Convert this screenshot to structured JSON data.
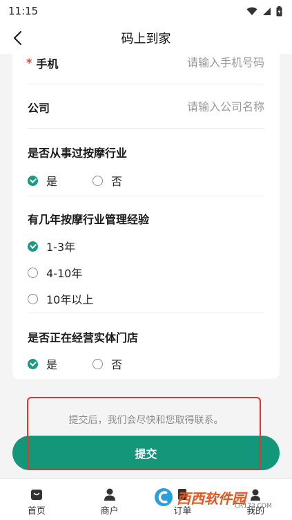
{
  "status_bar": {
    "time": "11:15"
  },
  "header": {
    "title": "码上到家"
  },
  "form": {
    "phone": {
      "required_mark": "*",
      "label": "手机",
      "placeholder": "请输入手机号码"
    },
    "company": {
      "label": "公司",
      "placeholder": "请输入公司名称"
    },
    "questions": [
      {
        "title": "是否从事过按摩行业",
        "options": [
          {
            "label": "是",
            "selected": true
          },
          {
            "label": "否",
            "selected": false
          }
        ]
      },
      {
        "title": "有几年按摩行业管理经验",
        "options": [
          {
            "label": "1-3年",
            "selected": true
          },
          {
            "label": "4-10年",
            "selected": false
          },
          {
            "label": "10年以上",
            "selected": false
          }
        ]
      },
      {
        "title": "是否正在经营实体门店",
        "options": [
          {
            "label": "是",
            "selected": true
          },
          {
            "label": "否",
            "selected": false
          }
        ]
      }
    ]
  },
  "notice": "提交后，我们会尽快和您取得联系。",
  "submit_label": "提交",
  "tab_bar": {
    "items": [
      {
        "label": "首页",
        "icon": "home-bag-icon"
      },
      {
        "label": "商户",
        "icon": "merchant-person-icon"
      },
      {
        "label": "订单",
        "icon": "order-icon"
      },
      {
        "label": "我的",
        "icon": "profile-icon"
      }
    ]
  },
  "watermark": {
    "brand": "西西软件园",
    "site": "CR173.COM"
  },
  "colors": {
    "accent": "#14967b",
    "check": "#1a9a82",
    "required": "#e04848",
    "highlight": "#d9382b"
  }
}
